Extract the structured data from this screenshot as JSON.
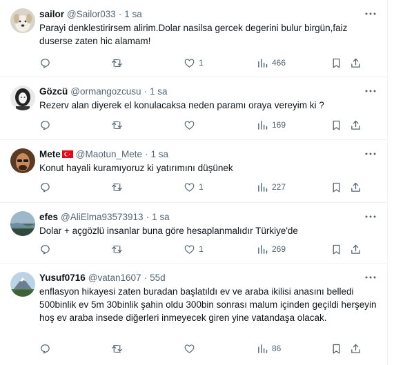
{
  "tweets": [
    {
      "name": "sailor",
      "handle": "@Sailor033",
      "dot": "·",
      "time": "1 sa",
      "text": "Parayi denklestirirsem alirim.Dolar nasilsa gercek degerini bulur birgün,faiz duserse zaten hic alamam!",
      "replies": "",
      "retweets": "",
      "likes": "1",
      "views": "466",
      "avatar": "dog-avatar"
    },
    {
      "name": "Gözcü",
      "handle": "@ormangozcusu",
      "dot": "·",
      "time": "1 sa",
      "text": "Rezerv alan diyerek el konulacaksa neden paramı oraya vereyim ki ?",
      "replies": "",
      "retweets": "",
      "likes": "",
      "views": "169",
      "avatar": "woman-avatar"
    },
    {
      "name": "Mete",
      "handle": "@Maotun_Mete",
      "dot": "·",
      "time": "1 sa",
      "text": "Konut hayali kuramıyoruz ki yatırımını düşünek",
      "replies": "",
      "retweets": "",
      "likes": "1",
      "views": "227",
      "avatar": "man-avatar"
    },
    {
      "name": "efes",
      "handle": "@AliElma93573913",
      "dot": "·",
      "time": "1 sa",
      "text": "Dolar + açgözlü insanlar buna göre hesaplanmalıdır Türkiye'de",
      "replies": "",
      "retweets": "",
      "likes": "1",
      "views": "269",
      "avatar": "landscape-avatar"
    },
    {
      "name": "Yusuf0716",
      "handle": "@vatan1607",
      "dot": "·",
      "time": "55d",
      "text": "enflasyon hikayesi zaten buradan başlatıldı ev ve araba ikilisi anasını belledi 500binlik ev 5m 30binlik şahin oldu 300bin sonrası malum içinden geçildi herşeyin hoş ev araba insede diğerleri inmeyecek giren yine vatandaşa olacak.",
      "replies": "",
      "retweets": "",
      "likes": "",
      "views": "86",
      "avatar": "mountain-avatar"
    }
  ],
  "colors": {
    "text": "#0f1419",
    "muted": "#536471",
    "border": "#eff3f4"
  }
}
